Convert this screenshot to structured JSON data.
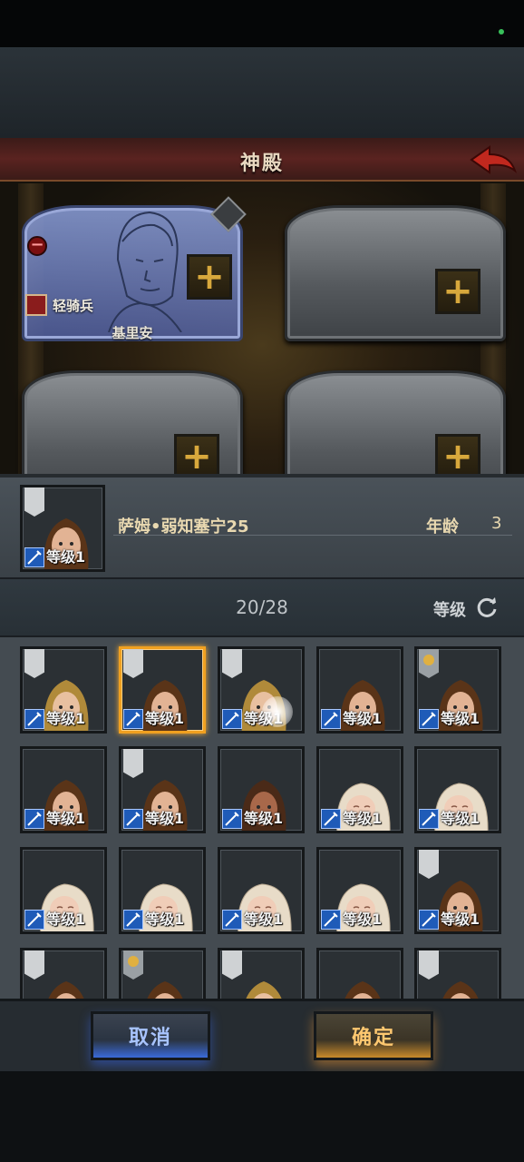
{
  "screen": {
    "title": "神殿"
  },
  "temple": {
    "slots": [
      {
        "state": "filled",
        "class_label": "轻骑兵",
        "name": "基里安"
      },
      {
        "state": "empty"
      },
      {
        "state": "empty"
      },
      {
        "state": "empty"
      }
    ]
  },
  "selected_info": {
    "name": "萨姆•弱知塞宁25",
    "age_label": "年龄",
    "age_value": "3",
    "level_label": "等级1"
  },
  "list": {
    "count": "20/28",
    "sort_label": "等级",
    "cards": [
      {
        "level": "等级1",
        "flag": "plain",
        "portrait": "woman-blonde"
      },
      {
        "level": "等级1",
        "flag": "plain",
        "portrait": "woman-brown",
        "selected": true
      },
      {
        "level": "等级1",
        "flag": "plain",
        "portrait": "woman-blonde"
      },
      {
        "level": "等级1",
        "flag": "none",
        "portrait": "woman-brown"
      },
      {
        "level": "等级1",
        "flag": "sun",
        "portrait": "woman-brown"
      },
      {
        "level": "等级1",
        "flag": "none",
        "portrait": "woman-brown"
      },
      {
        "level": "等级1",
        "flag": "plain",
        "portrait": "woman-brown"
      },
      {
        "level": "等级1",
        "flag": "none",
        "portrait": "man-dark"
      },
      {
        "level": "等级1",
        "flag": "none",
        "portrait": "baby"
      },
      {
        "level": "等级1",
        "flag": "none",
        "portrait": "baby"
      },
      {
        "level": "等级1",
        "flag": "none",
        "portrait": "baby"
      },
      {
        "level": "等级1",
        "flag": "none",
        "portrait": "baby"
      },
      {
        "level": "等级1",
        "flag": "none",
        "portrait": "baby"
      },
      {
        "level": "等级1",
        "flag": "none",
        "portrait": "baby"
      },
      {
        "level": "等级1",
        "flag": "plain",
        "portrait": "woman-brown"
      },
      {
        "level": "",
        "flag": "plain",
        "portrait": "woman-brown"
      },
      {
        "level": "",
        "flag": "sun",
        "portrait": "woman-brown"
      },
      {
        "level": "",
        "flag": "plain",
        "portrait": "woman-blonde"
      },
      {
        "level": "",
        "flag": "none",
        "portrait": "woman-brown"
      },
      {
        "level": "",
        "flag": "plain",
        "portrait": "woman-brown"
      }
    ]
  },
  "buttons": {
    "cancel": "取消",
    "confirm": "确定"
  },
  "colors": {
    "accent_gold": "#d8a83c",
    "cancel_blue": "#3a6ad8",
    "confirm_orange": "#c88a2a",
    "selected_border": "#f0a020"
  }
}
